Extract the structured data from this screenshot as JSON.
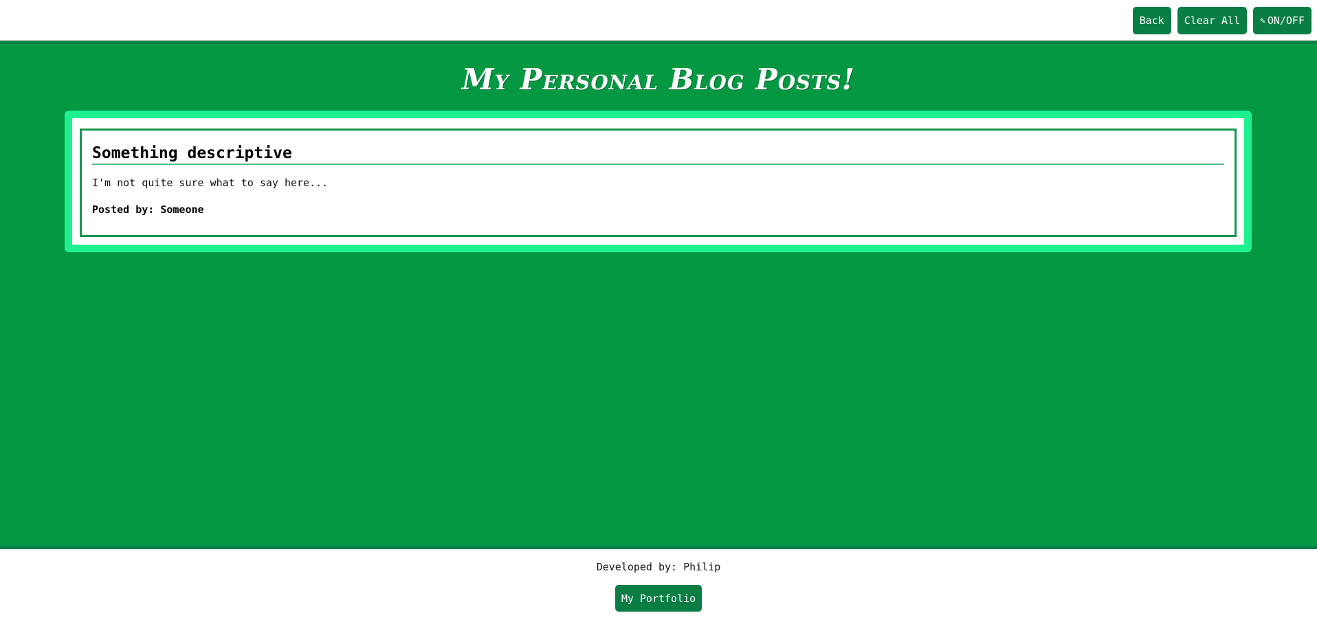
{
  "header": {
    "back_label": "Back",
    "clear_all_label": "Clear All",
    "toggle_icon": "pen-icon",
    "toggle_label": "ON/OFF"
  },
  "main": {
    "title": "My Personal Blog Posts!",
    "posts": [
      {
        "title": "Something descriptive",
        "content": "I'm not quite sure what to say here...",
        "author": "Posted by: Someone"
      }
    ]
  },
  "footer": {
    "credit": "Developed by: Philip",
    "portfolio_label": "My Portfolio"
  },
  "colors": {
    "accent": "#0a7d45",
    "background": "#059843",
    "frame_border": "#1cf08f",
    "card_border": "#13954e"
  }
}
